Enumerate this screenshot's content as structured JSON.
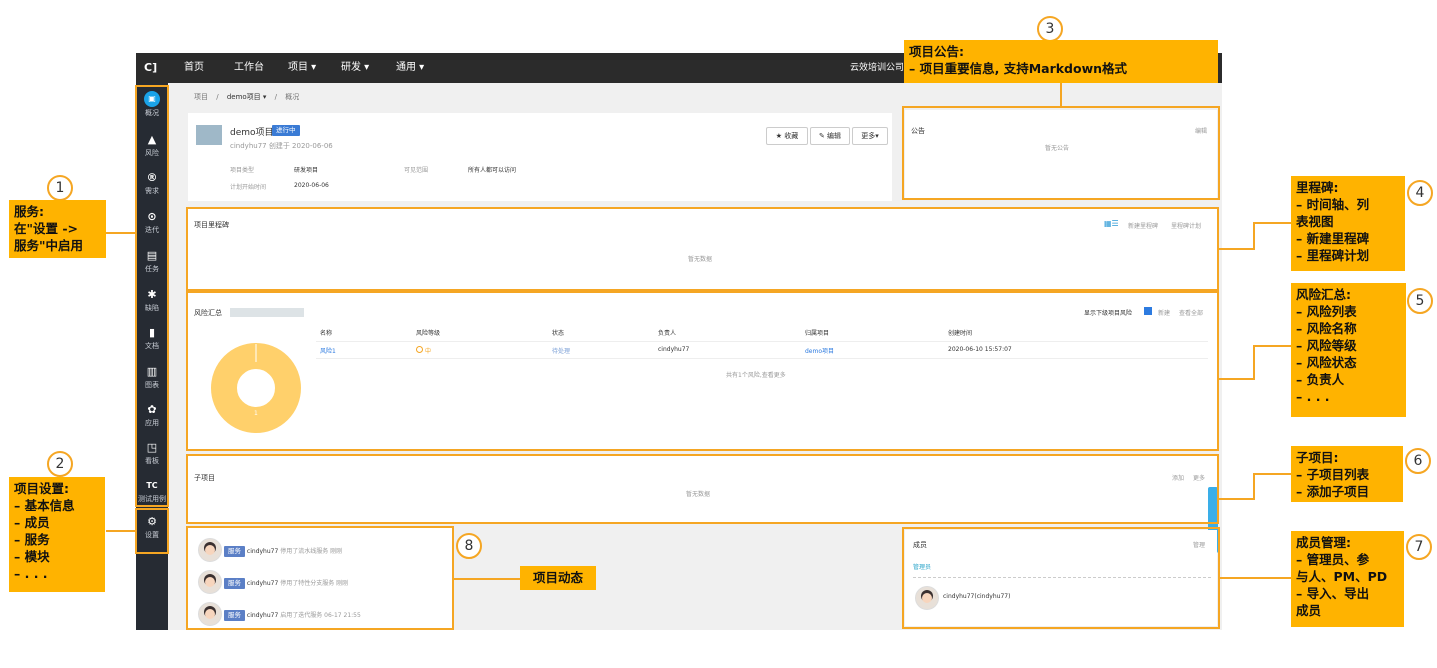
{
  "topbar": {
    "logo": "C]",
    "nav": [
      "首页",
      "工作台",
      "项目 ▾",
      "研发 ▾",
      "通用 ▾"
    ],
    "org": "云效培训公司"
  },
  "sidebar": {
    "items": [
      {
        "icon": "▣",
        "label": "概况"
      },
      {
        "icon": "▲",
        "label": "风险"
      },
      {
        "icon": "®",
        "label": "需求"
      },
      {
        "icon": "⊙",
        "label": "迭代"
      },
      {
        "icon": "▤",
        "label": "任务"
      },
      {
        "icon": "✱",
        "label": "缺陷"
      },
      {
        "icon": "▮",
        "label": "文档"
      },
      {
        "icon": "▥",
        "label": "图表"
      },
      {
        "icon": "✿",
        "label": "应用"
      },
      {
        "icon": "◳",
        "label": "看板"
      },
      {
        "icon": "TC",
        "label": "测试用例"
      },
      {
        "icon": "⚙",
        "label": "设置"
      }
    ]
  },
  "breadcrumb": {
    "root": "项目",
    "project": "demo项目 ▾",
    "page": "概况"
  },
  "project": {
    "name": "demo项目",
    "status": "进行中",
    "creator_line": "cindyhu77 创建于 2020-06-06",
    "type_label": "项目类型",
    "type_value": "研发项目",
    "visibility_label": "可见范围",
    "visibility_value": "所有人都可以访问",
    "start_label": "计划开始时间",
    "start_value": "2020-06-06",
    "buttons": {
      "favorite": "★ 收藏",
      "edit": "✎ 编辑",
      "more": "更多▾"
    }
  },
  "announcement": {
    "title": "公告",
    "edit": "编辑",
    "empty": "暂无公告"
  },
  "milestone": {
    "title": "项目里程碑",
    "new": "新建里程碑",
    "plan": "里程碑计划",
    "empty": "暂无数据"
  },
  "risk": {
    "title": "风险汇总",
    "show_sub": "显示下级项目风险",
    "new": "新建",
    "view_all": "查看全部",
    "columns": [
      "名称",
      "风险等级",
      "状态",
      "负责人",
      "归属项目",
      "创建时间"
    ],
    "rows": [
      [
        "风险1",
        "中",
        "待处理",
        "cindyhu77",
        "demo项目",
        "2020-06-10 15:57:07"
      ]
    ],
    "footer": "共有1个风险,查看更多",
    "donut_count": "1",
    "chart_data": {
      "type": "pie",
      "categories": [
        "中"
      ],
      "values": [
        1
      ]
    }
  },
  "subproject": {
    "title": "子项目",
    "add": "添加",
    "more": "更多",
    "empty": "暂无数据"
  },
  "activity": {
    "items": [
      {
        "tag": "服务",
        "user": "cindyhu77",
        "text": "停用了流水线服务",
        "time": "刚刚"
      },
      {
        "tag": "服务",
        "user": "cindyhu77",
        "text": "停用了特性分支服务",
        "time": "刚刚"
      },
      {
        "tag": "服务",
        "user": "cindyhu77",
        "text": "启用了迭代服务",
        "time": "06-17 21:55"
      }
    ]
  },
  "members": {
    "title": "成员",
    "manage": "管理",
    "group": "管理员",
    "member": "cindyhu77(cindyhu77)"
  },
  "annotations": {
    "c1": {
      "num": "1",
      "lines": [
        "服务:",
        "在\"设置 ->",
        "服务\"中启用"
      ]
    },
    "c2": {
      "num": "2",
      "lines": [
        "项目设置:",
        "– 基本信息",
        "– 成员",
        "– 服务",
        "– 模块",
        "– . . ."
      ]
    },
    "c3": {
      "num": "3",
      "lines": [
        "项目公告:",
        "– 项目重要信息, 支持Markdown格式"
      ]
    },
    "c4": {
      "num": "4",
      "lines": [
        "里程碑:",
        "– 时间轴、列",
        "表视图",
        "– 新建里程碑",
        "– 里程碑计划"
      ]
    },
    "c5": {
      "num": "5",
      "lines": [
        "风险汇总:",
        "– 风险列表",
        "– 风险名称",
        "– 风险等级",
        "– 风险状态",
        "– 负责人",
        "– . . ."
      ]
    },
    "c6": {
      "num": "6",
      "lines": [
        "子项目:",
        "– 子项目列表",
        "– 添加子项目"
      ]
    },
    "c7": {
      "num": "7",
      "lines": [
        "成员管理:",
        "– 管理员、参",
        "与人、PM、PD",
        "– 导入、导出",
        "成员"
      ]
    },
    "c8": {
      "num": "8",
      "label": "项目动态"
    }
  },
  "colors": {
    "accent": "#f5a623",
    "callout": "#ffb300",
    "topbar": "#2b2b2b",
    "sidebar": "#262b33",
    "status": "#3a7bd5",
    "donut": "#ffd06b"
  }
}
